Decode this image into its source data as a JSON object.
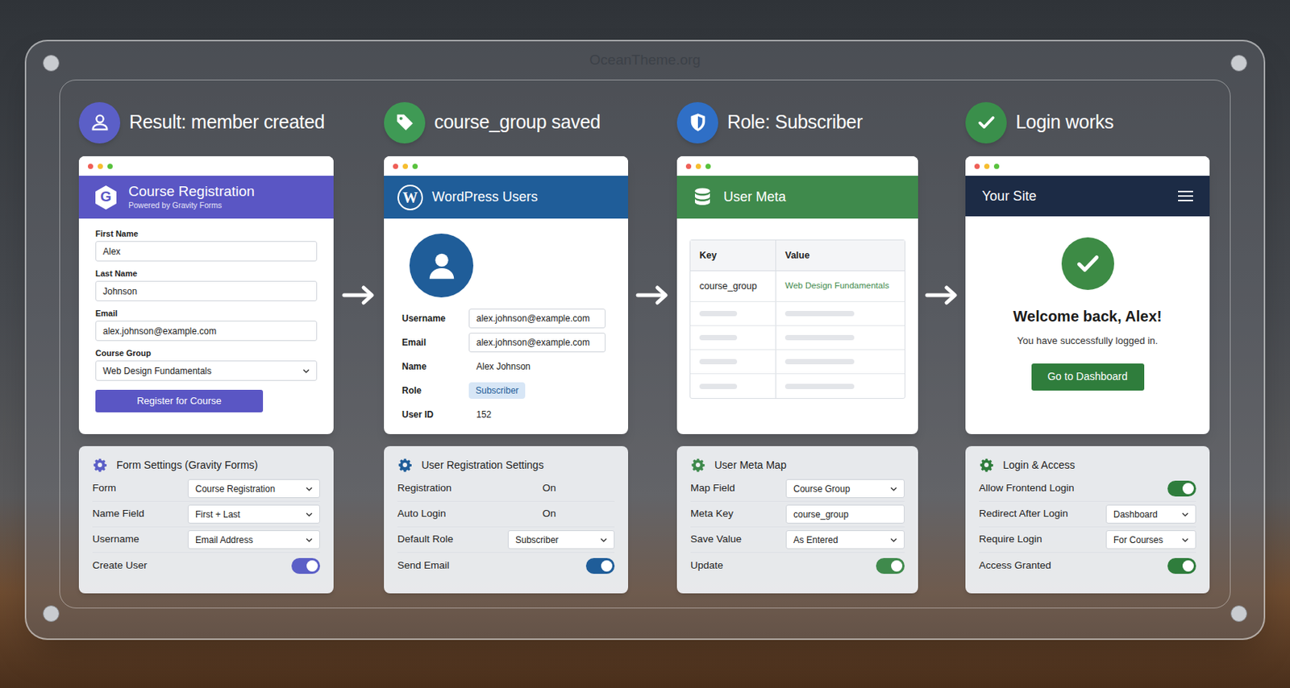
{
  "brand": "OceanTheme.org",
  "steps": [
    {
      "title": "Result: member created",
      "color": "#5b5fc7",
      "card": {
        "kind": "form",
        "logo": "G",
        "title": "Course Registration",
        "subtitle": "Powered by Gravity Forms",
        "color": "#5a56c4",
        "fields": [
          {
            "label": "First Name",
            "value": "Alex",
            "kind": "text"
          },
          {
            "label": "Last Name",
            "value": "Johnson",
            "kind": "text"
          },
          {
            "label": "Email",
            "value": "alex.johnson@example.com",
            "kind": "text"
          },
          {
            "label": "Course Group",
            "value": "Web Design Fundamentals",
            "kind": "select"
          }
        ],
        "button": "Register for Course"
      },
      "settings": {
        "title": "Form Settings (Gravity Forms)",
        "color": "#5b5fc7",
        "rows": [
          {
            "label": "Form",
            "kind": "select",
            "value": "Course Registration"
          },
          {
            "label": "Name Field",
            "kind": "select",
            "value": "First + Last"
          },
          {
            "label": "Username",
            "kind": "select",
            "value": "Email Address"
          },
          {
            "label": "Create User",
            "kind": "toggle",
            "on": true
          }
        ]
      }
    },
    {
      "title": "course_group saved",
      "color": "#3f9a55",
      "card": {
        "kind": "user",
        "logo": "W",
        "title": "WordPress Users",
        "color": "#1f5d99",
        "fields": [
          {
            "label": "Username",
            "value": "alex.johnson@example.com",
            "kind": "input"
          },
          {
            "label": "Email",
            "value": "alex.johnson@example.com",
            "kind": "input"
          },
          {
            "label": "Name",
            "value": "Alex Johnson",
            "kind": "plain"
          },
          {
            "label": "Role",
            "value": "Subscriber",
            "kind": "badge"
          },
          {
            "label": "User ID",
            "value": "152",
            "kind": "plain"
          }
        ]
      },
      "settings": {
        "title": "User Registration Settings",
        "color": "#1f5d99",
        "rows": [
          {
            "label": "Registration",
            "kind": "text",
            "value": "On"
          },
          {
            "label": "Auto Login",
            "kind": "text",
            "value": "On"
          },
          {
            "label": "Default Role",
            "kind": "select",
            "value": "Subscriber"
          },
          {
            "label": "Send Email",
            "kind": "toggle",
            "on": true
          }
        ]
      }
    },
    {
      "title": "Role: Subscriber",
      "color": "#2f6fc6",
      "card": {
        "kind": "meta",
        "title": "User Meta",
        "color": "#3f8a4c",
        "columns": [
          "Key",
          "Value"
        ],
        "rows": [
          {
            "key": "course_group",
            "value": "Web Design Fundamentals",
            "placeholder": false
          },
          {
            "placeholder": true
          },
          {
            "placeholder": true
          },
          {
            "placeholder": true
          },
          {
            "placeholder": true
          }
        ]
      },
      "settings": {
        "title": "User Meta Map",
        "color": "#3f8a4c",
        "rows": [
          {
            "label": "Map Field",
            "kind": "select",
            "value": "Course Group"
          },
          {
            "label": "Meta Key",
            "kind": "input",
            "value": "course_group"
          },
          {
            "label": "Save Value",
            "kind": "select",
            "value": "As Entered"
          },
          {
            "label": "Update",
            "kind": "toggle",
            "on": true
          }
        ]
      }
    },
    {
      "title": "Login works",
      "color": "#3a8f4b",
      "card": {
        "kind": "login",
        "title": "Your Site",
        "color": "#1c2b45",
        "heading": "Welcome back, Alex!",
        "message": "You have successfully logged in.",
        "button": "Go to Dashboard"
      },
      "settings": {
        "title": "Login & Access",
        "color": "#2f7d3c",
        "rows": [
          {
            "label": "Allow Frontend Login",
            "kind": "toggle",
            "on": true
          },
          {
            "label": "Redirect After Login",
            "kind": "select",
            "value": "Dashboard"
          },
          {
            "label": "Require Login",
            "kind": "select",
            "value": "For Courses"
          },
          {
            "label": "Access Granted",
            "kind": "toggle",
            "on": true
          }
        ]
      }
    }
  ]
}
